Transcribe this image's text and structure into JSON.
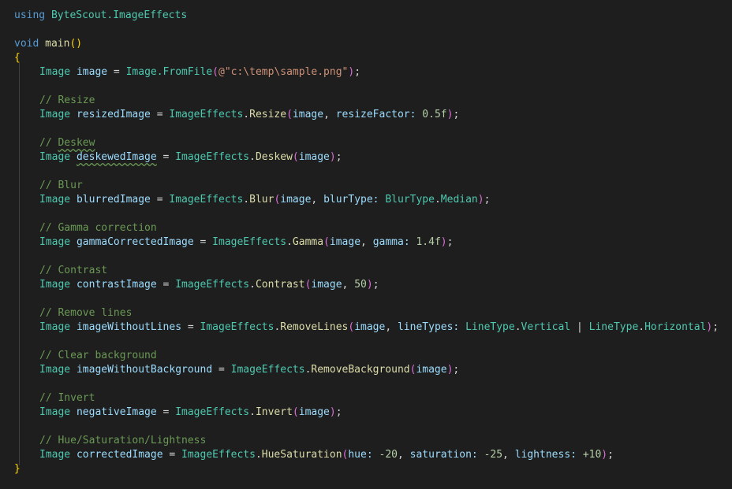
{
  "colors": {
    "background": "#1e1e1e",
    "keyword": "#569cd6",
    "type": "#4ec9b0",
    "function": "#dcdcaa",
    "variable": "#9cdcfe",
    "string": "#ce9178",
    "number": "#b5cea8",
    "comment": "#6a9955",
    "bracket1": "#ffd700",
    "bracket2": "#da70d6"
  },
  "code": {
    "using_kw": "using",
    "namespace": "ByteScout.ImageEffects",
    "void_kw": "void",
    "main_fn": "main",
    "load": {
      "type": "Image",
      "var": "image",
      "method": "Image.FromFile",
      "str_prefix": "@",
      "path": "\"c:\\temp\\sample.png\""
    },
    "resize": {
      "comment": "// Resize",
      "var": "resizedImage",
      "method": "Resize",
      "param": "resizeFactor:",
      "value": "0.5f"
    },
    "deskew": {
      "comment_prefix": "// ",
      "comment_word": "Deskew",
      "var": "deskewedImage",
      "method": "Deskew"
    },
    "blur": {
      "comment": "// Blur",
      "var": "blurredImage",
      "method": "Blur",
      "param": "blurType:",
      "enum_type": "BlurType",
      "enum_value": "Median"
    },
    "gamma": {
      "comment": "// Gamma correction",
      "var": "gammaCorrectedImage",
      "method": "Gamma",
      "param": "gamma:",
      "value": "1.4f"
    },
    "contrast": {
      "comment": "// Contrast",
      "var": "contrastImage",
      "method": "Contrast",
      "value": "50"
    },
    "removelines": {
      "comment": "// Remove lines",
      "var": "imageWithoutLines",
      "method": "RemoveLines",
      "param": "lineTypes:",
      "enum_type": "LineType",
      "enum_value1": "Vertical",
      "enum_value2": "Horizontal"
    },
    "removebg": {
      "comment": "// Clear background",
      "var": "imageWithoutBackground",
      "method": "RemoveBackground"
    },
    "invert": {
      "comment": "// Invert",
      "var": "negativeImage",
      "method": "Invert"
    },
    "hue": {
      "comment": "// Hue/Saturation/Lightness",
      "var": "correctedImage",
      "method": "HueSaturation",
      "param1": "hue:",
      "value1": "-20",
      "param2": "saturation:",
      "value2": "-25",
      "param3": "lightness:",
      "value3": "+10"
    },
    "class_name": "ImageEffects",
    "type_name": "Image",
    "arg_name": "image"
  }
}
